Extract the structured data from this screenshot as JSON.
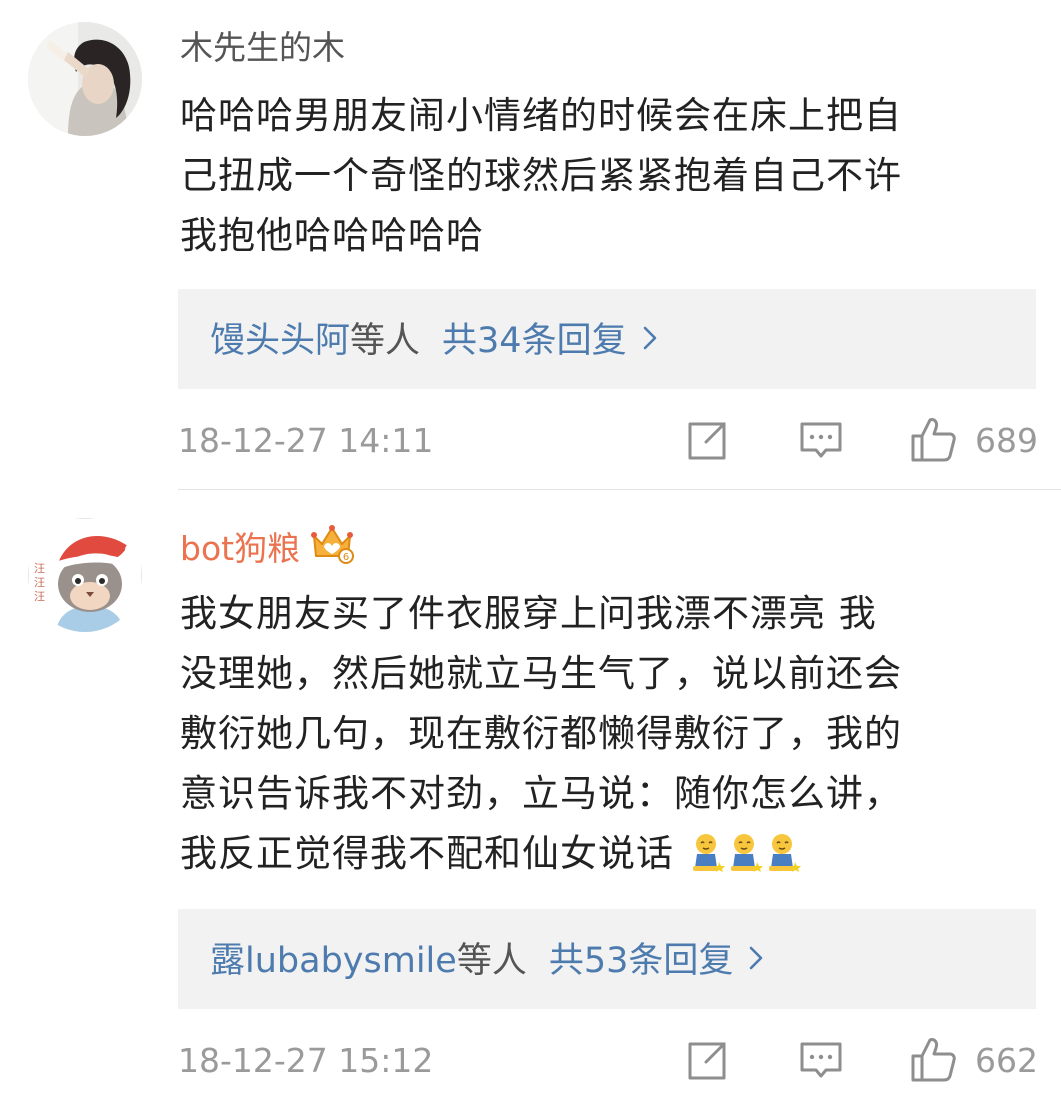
{
  "comments": [
    {
      "username": "木先生的木",
      "body_lines": [
        "哈哈哈男朋友闹小情绪的时候会在床上把自",
        "己扭成一个奇怪的球然后紧紧抱着自己不许",
        "我抱他哈哈哈哈哈"
      ],
      "reply_users": "馒头头阿",
      "reply_etc": "等人",
      "reply_count": "共34条回复",
      "timestamp": "18-12-27 14:11",
      "likes": "689",
      "avatar_icon": "user-photo-avatar"
    },
    {
      "username": "bot狗粮",
      "badge_icon": "crown-vip-icon",
      "body_lines": [
        "我女朋友买了件衣服穿上问我漂不漂亮 我",
        "没理她，然后她就立马生气了，说以前还会",
        "敷衍她几句，现在敷衍都懒得敷衍了，我的",
        "意识告诉我不对劲，立马说：随你怎么讲，",
        "我反正觉得我不配和仙女说话"
      ],
      "emoji_icon": "kneeling-emoji",
      "reply_users": "露lubabysmile",
      "reply_etc": "等人",
      "reply_count": "共53条回复",
      "timestamp": "18-12-27 15:12",
      "likes": "662",
      "avatar_icon": "cartoon-cat-santa-avatar"
    }
  ],
  "colors": {
    "username_orange": "#eb7350",
    "link_blue": "#4d7bae",
    "meta_gray": "#9a9a9a",
    "reply_bg": "#f2f2f2"
  }
}
